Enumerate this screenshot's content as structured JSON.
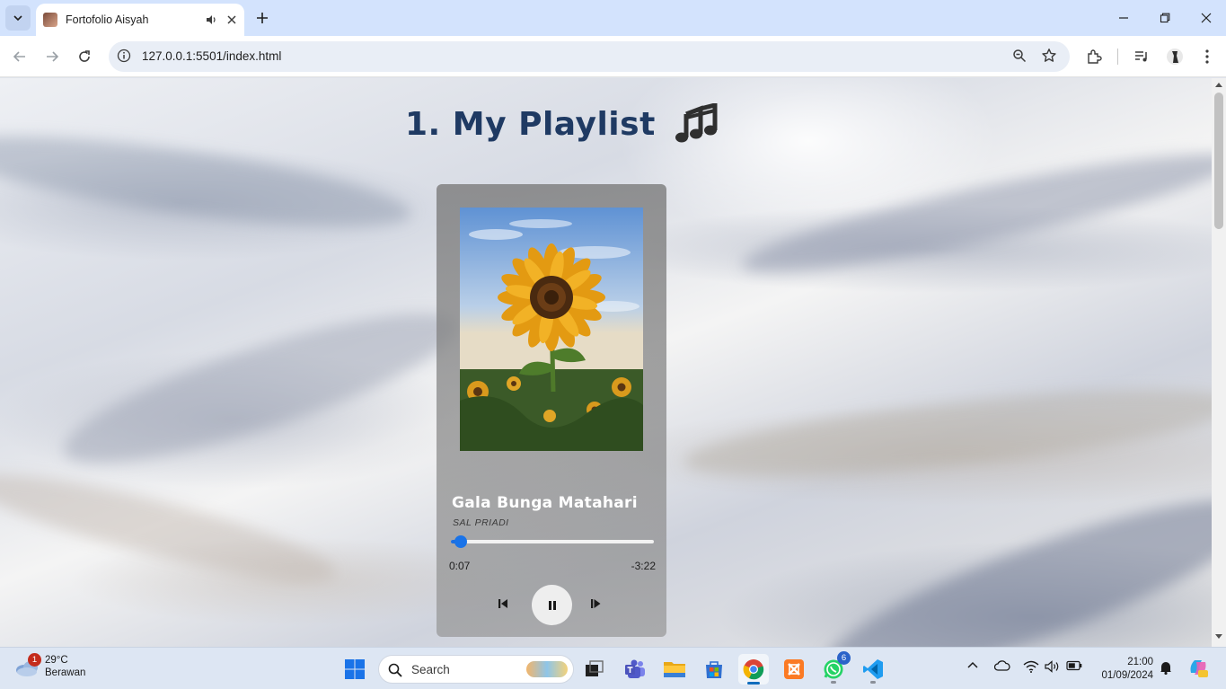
{
  "browser": {
    "tab": {
      "title": "Fortofolio Aisyah"
    },
    "url": "127.0.0.1:5501/index.html"
  },
  "page": {
    "title": "1. My Playlist",
    "player": {
      "song_title": "Gala Bunga Matahari",
      "artist": "SAL PRIADI",
      "elapsed": "0:07",
      "remaining": "-3:22",
      "progress": 0.05,
      "state": "playing",
      "cover_image": "sunflower"
    }
  },
  "taskbar": {
    "weather": {
      "temp": "29°C",
      "condition": "Berawan",
      "badge": "1"
    },
    "search_label": "Search",
    "whatsapp_badge": "6",
    "clock": {
      "time": "21:00",
      "date": "01/09/2024"
    }
  },
  "colors": {
    "title": "#1f3a63",
    "progress": "#1a73e8",
    "chrome_tabbar": "#d3e3fd"
  }
}
